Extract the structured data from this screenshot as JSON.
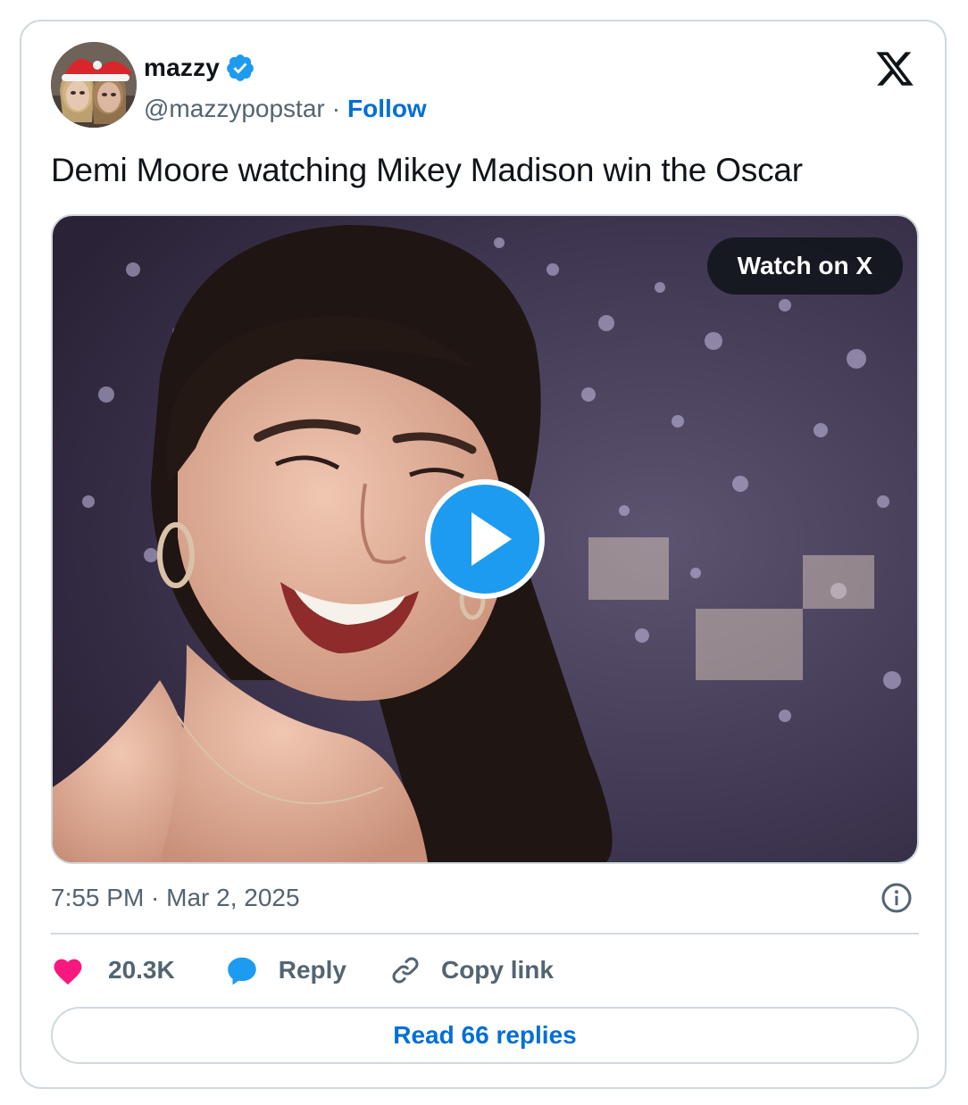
{
  "author": {
    "name": "mazzy",
    "handle": "@mazzypopstar",
    "separator": "·",
    "follow_label": "Follow",
    "verified": true,
    "avatar_icon": "avatar-photo"
  },
  "brand": {
    "logo_icon": "x-logo-icon"
  },
  "tweet": {
    "text": "Demi Moore watching Mikey Madison win the Oscar",
    "timestamp": "7:55 PM · Mar 2, 2025"
  },
  "media": {
    "type": "video",
    "watch_label": "Watch on X",
    "play_icon": "play-icon"
  },
  "actions": {
    "like_count": "20.3K",
    "reply_label": "Reply",
    "copy_link_label": "Copy link"
  },
  "footer": {
    "read_replies_label": "Read 66 replies"
  },
  "colors": {
    "link_blue": "#006fd6",
    "verified_blue": "#1d9bf0",
    "heart_pink": "#f91880",
    "text_primary": "#0f1419",
    "text_secondary": "#536471",
    "border": "#cfd9de"
  }
}
